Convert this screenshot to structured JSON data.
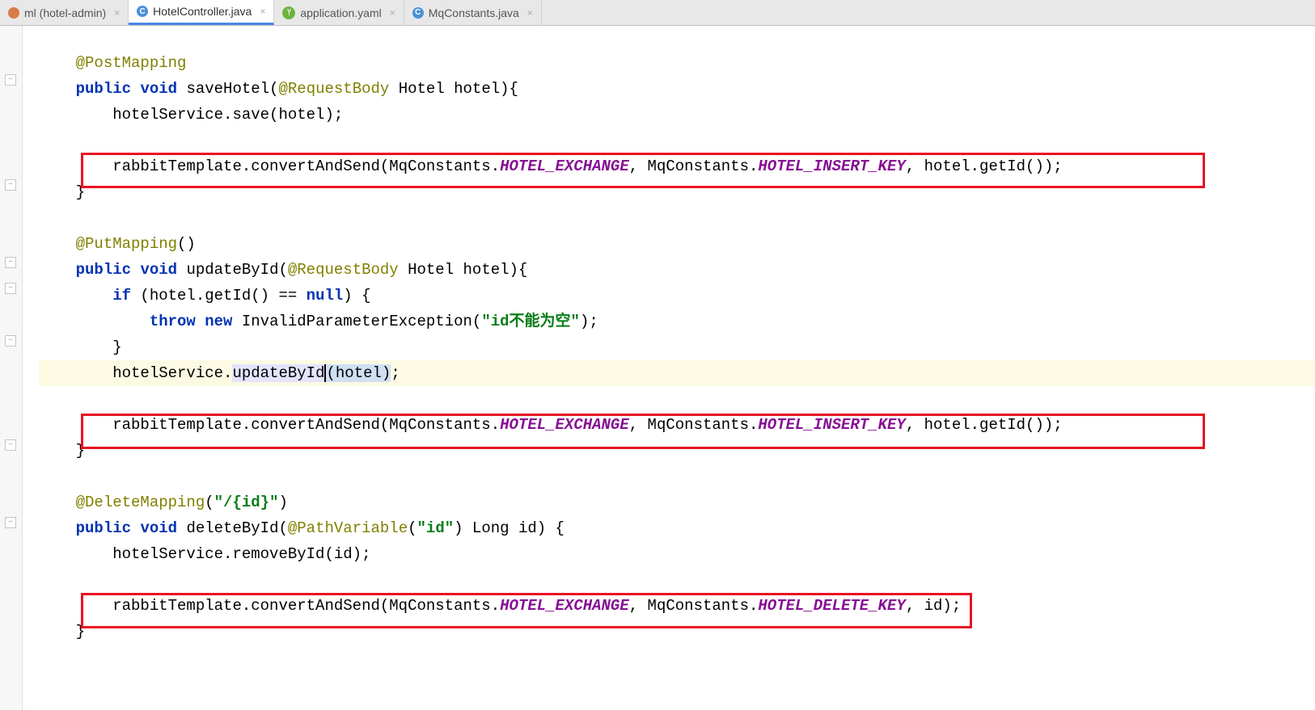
{
  "tabs": [
    {
      "label": "ml (hotel-admin)",
      "icon": "xml",
      "active": false
    },
    {
      "label": "HotelController.java",
      "icon": "java",
      "active": true
    },
    {
      "label": "application.yaml",
      "icon": "yaml",
      "active": false
    },
    {
      "label": "MqConstants.java",
      "icon": "java",
      "active": false
    }
  ],
  "code": {
    "l1_ann": "@PostMapping",
    "l2_kw1": "public",
    "l2_kw2": "void",
    "l2_name": "saveHotel(",
    "l2_ann": "@RequestBody",
    "l2_rest": " Hotel hotel){",
    "l3": "    hotelService.save(hotel);",
    "l4_blank": "",
    "l5_a": "    rabbitTemplate.convertAndSend(MqConstants.",
    "l5_c1": "HOTEL_EXCHANGE",
    "l5_b": ", MqConstants.",
    "l5_c2": "HOTEL_INSERT_KEY",
    "l5_c": ", hotel.getId());",
    "l6": "}",
    "l7_blank": "",
    "l8_ann": "@PutMapping",
    "l8_rest": "()",
    "l9_kw1": "public",
    "l9_kw2": "void",
    "l9_name": "updateById(",
    "l9_ann": "@RequestBody",
    "l9_rest": " Hotel hotel){",
    "l10_a": "    ",
    "l10_kw": "if",
    "l10_b": " (hotel.getId() == ",
    "l10_kw2": "null",
    "l10_c": ") {",
    "l11_a": "        ",
    "l11_kw1": "throw",
    "l11_kw2": "new",
    "l11_b": " InvalidParameterException(",
    "l11_str": "\"id不能为空\"",
    "l11_c": ");",
    "l12": "    }",
    "l13_a": "    hotelService.",
    "l13_hl": "updateById",
    "l13_b": "(hotel)",
    "l13_c": ";",
    "l14_blank": "",
    "l15_a": "    rabbitTemplate.convertAndSend(MqConstants.",
    "l15_c1": "HOTEL_EXCHANGE",
    "l15_b": ", MqConstants.",
    "l15_c2": "HOTEL_INSERT_KEY",
    "l15_c": ", hotel.getId());",
    "l16": "}",
    "l17_blank": "",
    "l18_ann": "@DeleteMapping",
    "l18_a": "(",
    "l18_str": "\"/{id}\"",
    "l18_b": ")",
    "l19_kw1": "public",
    "l19_kw2": "void",
    "l19_name": "deleteById(",
    "l19_ann": "@PathVariable",
    "l19_a": "(",
    "l19_str": "\"id\"",
    "l19_b": ") Long id) {",
    "l20": "    hotelService.removeById(id);",
    "l21_blank": "",
    "l22_a": "    rabbitTemplate.convertAndSend(MqConstants.",
    "l22_c1": "HOTEL_EXCHANGE",
    "l22_b": ", MqConstants.",
    "l22_c2": "HOTEL_DELETE_KEY",
    "l22_c": ", id);",
    "l23": "}"
  }
}
